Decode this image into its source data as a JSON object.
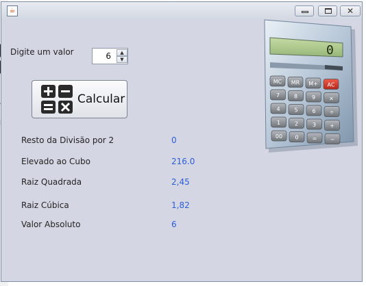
{
  "window": {
    "app_icon": "java-icon",
    "controls": [
      "minimize-icon",
      "maximize-icon",
      "close-icon"
    ]
  },
  "input": {
    "label": "Digite um valor",
    "value": "6"
  },
  "button": {
    "label": "Calcular",
    "icon": "calculator-operations-icon"
  },
  "calculator_image": {
    "display": "0",
    "keys": [
      "MC",
      "MR",
      "M+",
      "AC",
      "7",
      "8",
      "9",
      "×",
      "4",
      "5",
      "6",
      "÷",
      "1",
      "2",
      "3",
      "+",
      "00",
      "0",
      "=",
      "−"
    ]
  },
  "results": [
    {
      "label": "Resto da Divisão por 2",
      "value": "0"
    },
    {
      "label": "Elevado ao Cubo",
      "value": "216.0"
    },
    {
      "label": "Raiz Quadrada",
      "value": "2,45"
    },
    {
      "label": "Raiz Cúbica",
      "value": "1,82"
    },
    {
      "label": "Valor Absoluto",
      "value": "6"
    }
  ],
  "background_fragments": [
    "ã",
    "b"
  ],
  "colors": {
    "window_bg": "#d4d7e3",
    "value_text": "#2b5cd8"
  }
}
